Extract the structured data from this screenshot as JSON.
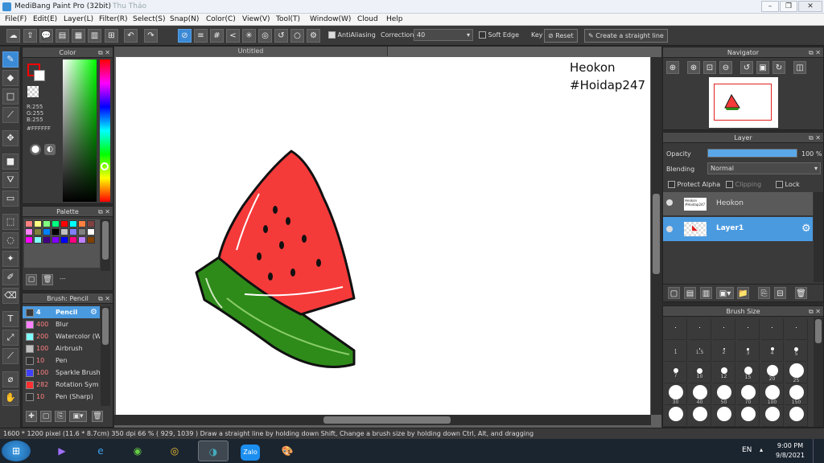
{
  "window": {
    "title": "MediBang Paint Pro (32bit)",
    "user": "Thu Thảo"
  },
  "menu": [
    "File(F)",
    "Edit(E)",
    "Layer(L)",
    "Filter(R)",
    "Select(S)",
    "Snap(N)",
    "Color(C)",
    "View(V)",
    "Tool(T)",
    "Window(W)",
    "Cloud",
    "Help"
  ],
  "toolbar": {
    "antialiasing_label": "AntiAliasing",
    "correction_label": "Correction",
    "correction_value": "40",
    "soft_edge_label": "Soft Edge",
    "key_label": "Key",
    "reset_label": "Reset",
    "straight_line_label": "Create a straight line"
  },
  "color_panel": {
    "title": "Color",
    "r": "R:255",
    "g": "G:255",
    "b": "B:255",
    "hex": "#FFFFFF",
    "primary_color": "#ff0000",
    "secondary_color": "#ffffff"
  },
  "palette_panel": {
    "title": "Palette",
    "dash_label": "---",
    "swatches": [
      "#ff8080",
      "#ffff80",
      "#80ff80",
      "#00ff80",
      "#ff0000",
      "#00ffff",
      "#ff8040",
      "#804040",
      "#ff80ff",
      "#808040",
      "#0080ff",
      "#000000",
      "#c0c0c0",
      "#8080ff",
      "#808080",
      "#ffffff",
      "#ff00ff",
      "#80ffff",
      "#400080",
      "#8000ff",
      "#0000ff",
      "#ff0080",
      "#c080ff",
      "#804000"
    ]
  },
  "brush_panel": {
    "title": "Brush: Pencil",
    "items": [
      {
        "size": "4",
        "name": "Pencil",
        "color": "#3a3a3a",
        "selected": true
      },
      {
        "size": "400",
        "name": "Blur",
        "color": "#ff80ff"
      },
      {
        "size": "200",
        "name": "Watercolor (W",
        "color": "#80ffff"
      },
      {
        "size": "100",
        "name": "Airbrush",
        "color": "#c0c0c0"
      },
      {
        "size": "10",
        "name": "Pen",
        "color": "#333333"
      },
      {
        "size": "100",
        "name": "Sparkle Brush",
        "color": "#4040ff"
      },
      {
        "size": "282",
        "name": "Rotation Sym",
        "color": "#ff3030"
      },
      {
        "size": "10",
        "name": "Pen (Sharp)",
        "color": "#333333"
      }
    ]
  },
  "canvas": {
    "tab_label": "Untitled",
    "text_line1": "Heokon",
    "text_line2": "#Hoidap247"
  },
  "navigator_panel": {
    "title": "Navigator"
  },
  "layer_panel": {
    "title": "Layer",
    "opacity_label": "Opacity",
    "opacity_value": "100 %",
    "opacity_fraction": 1.0,
    "blending_label": "Blending",
    "blending_value": "Normal",
    "protect_alpha_label": "Protect Alpha",
    "clipping_label": "Clipping",
    "lock_label": "Lock",
    "layers": [
      {
        "name": "Heokon",
        "thumb_text": "Heokon #Hoidap247",
        "selected": false
      },
      {
        "name": "Layer1",
        "selected": true
      }
    ]
  },
  "brush_size_panel": {
    "title": "Brush Size",
    "sizes": [
      "",
      "",
      "",
      "",
      "",
      "",
      "1",
      "1.5",
      "2",
      "3",
      "4",
      "5",
      "7",
      "10",
      "12",
      "15",
      "20",
      "25",
      "30",
      "40",
      "50",
      "70",
      "100",
      "150",
      "",
      "",
      "",
      "",
      "",
      ""
    ]
  },
  "status": {
    "text": "1600 * 1200 pixel   (11.6 * 8.7cm)   350 dpi   66 %   ( 929, 1039 )   Draw a straight line by holding down Shift, Change a brush size by holding down Ctrl, Alt, and dragging"
  },
  "taskbar": {
    "lang": "EN",
    "time": "9:00 PM",
    "date": "9/8/2021",
    "zalo_label": "Zalo"
  }
}
